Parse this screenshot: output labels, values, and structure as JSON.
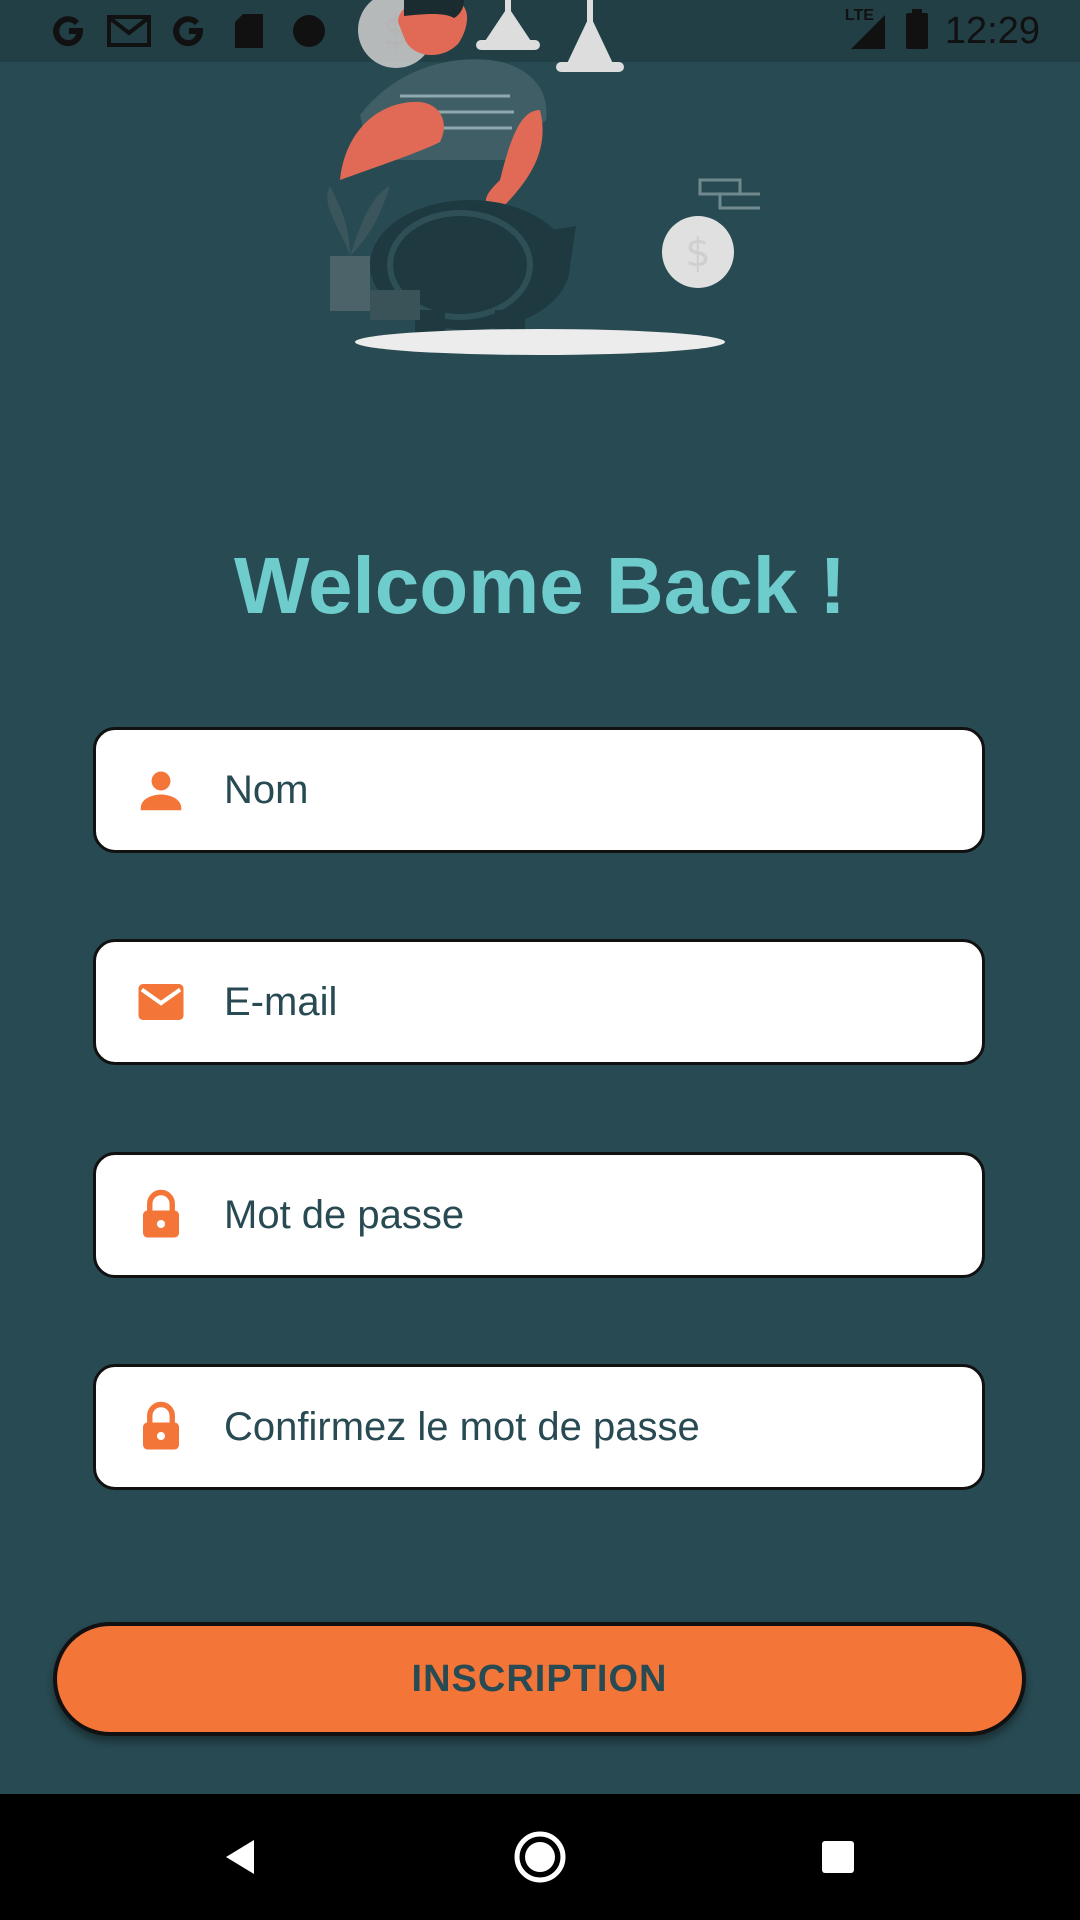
{
  "status_bar": {
    "time": "12:29",
    "network": "LTE",
    "left_icons": [
      "google-icon",
      "gmail-icon",
      "google-icon",
      "sd-card-icon",
      "circle-dot-icon"
    ],
    "right_icons": [
      "signal-icon",
      "battery-icon"
    ]
  },
  "illustration": {
    "icon": "piggy-bank-saving-illustration"
  },
  "heading": "Welcome Back !",
  "form": {
    "name": {
      "placeholder": "Nom",
      "value": "",
      "icon": "person-icon"
    },
    "email": {
      "placeholder": "E-mail",
      "value": "",
      "icon": "mail-icon"
    },
    "password": {
      "placeholder": "Mot de passe",
      "value": "",
      "icon": "lock-icon"
    },
    "confirm_password": {
      "placeholder": "Confirmez le mot de passe",
      "value": "",
      "icon": "lock-icon"
    }
  },
  "submit_label": "INSCRIPTION",
  "navigation": {
    "buttons": [
      "back-icon",
      "home-icon",
      "recents-icon"
    ]
  },
  "colors": {
    "background": "#284a52",
    "accent": "#f37638",
    "heading": "#6fcccc",
    "field_bg": "#ffffff",
    "field_text": "#284a52"
  }
}
